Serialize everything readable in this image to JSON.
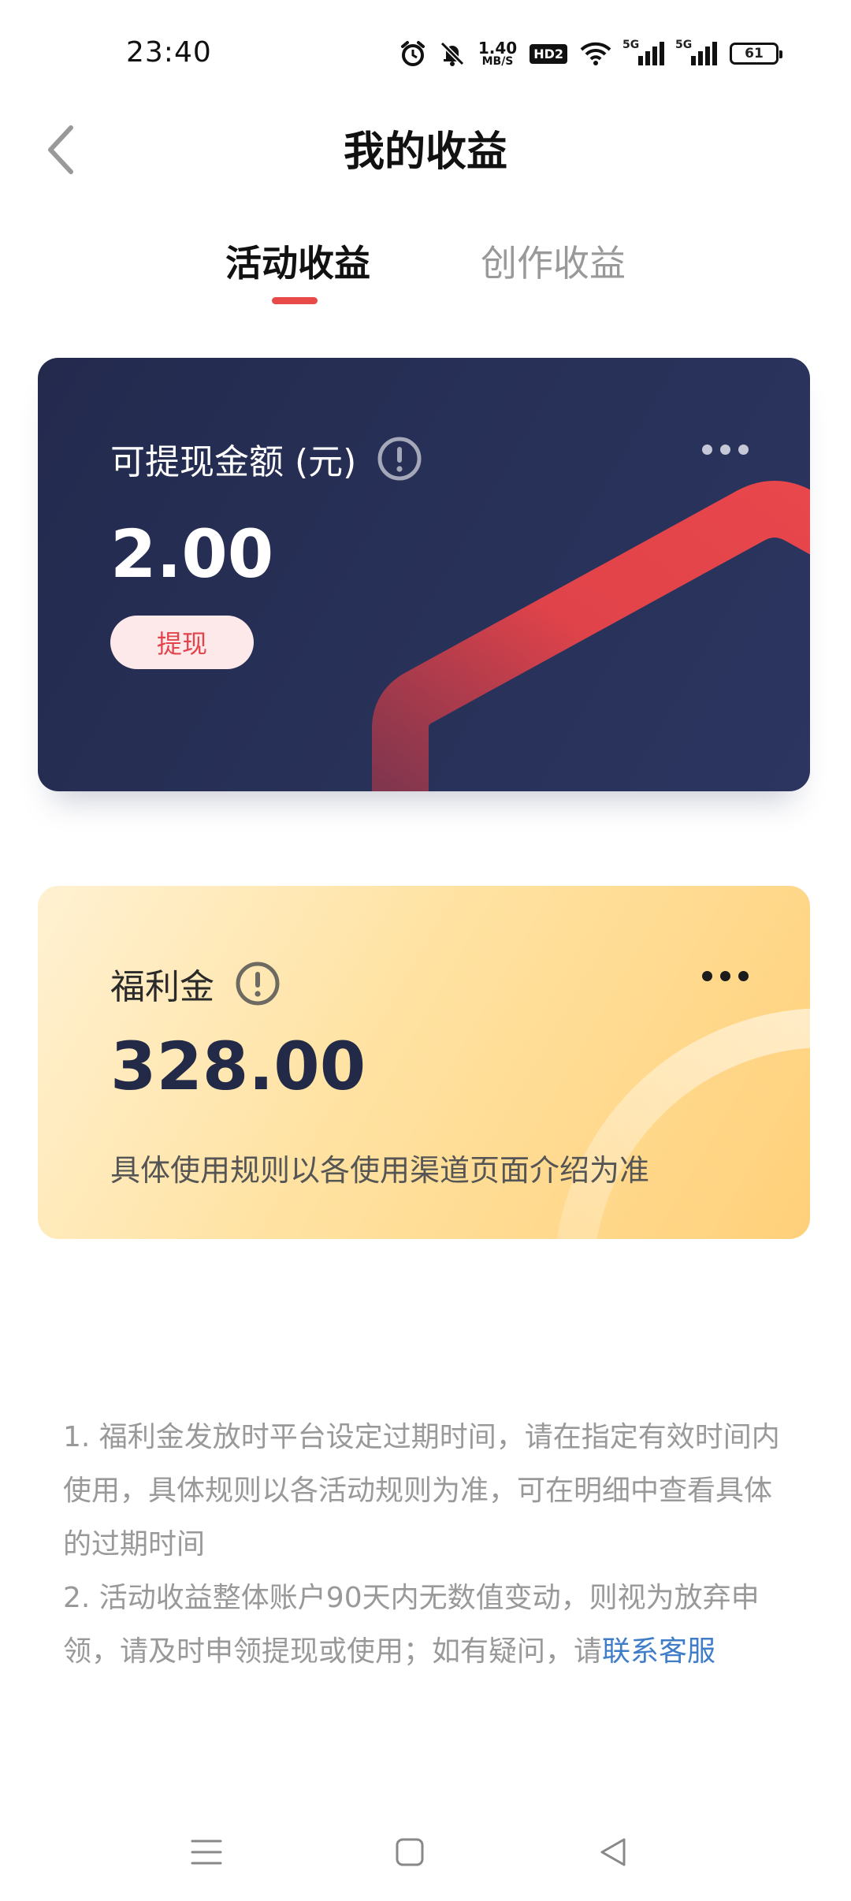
{
  "status_bar": {
    "time": "23:40",
    "net_speed_value": "1.40",
    "net_speed_unit": "MB/S",
    "hd_badge": "HD2",
    "signal1_tag": "5G",
    "signal2_tag": "5G",
    "battery": "61",
    "icons": [
      "alarm-icon",
      "mute-icon",
      "wifi-icon",
      "signal-icon",
      "battery-icon"
    ]
  },
  "header": {
    "title": "我的收益"
  },
  "tabs": [
    {
      "label": "活动收益",
      "active": true
    },
    {
      "label": "创作收益",
      "active": false
    }
  ],
  "balance_card": {
    "label": "可提现金额 (元)",
    "value": "2.00",
    "withdraw_label": "提现"
  },
  "welfare_card": {
    "label": "福利金",
    "value": "328.00",
    "description": "具体使用规则以各使用渠道页面介绍为准"
  },
  "notes": {
    "line1": "1. 福利金发放时平台设定过期时间，请在指定有效时间内使用，具体规则以各活动规则为准，可在明细中查看具体的过期时间",
    "line2_prefix": "2. 活动收益整体账户90天内无数值变动，则视为放弃申领，请及时申领提现或使用；如有疑问，请",
    "contact_link": "联系客服"
  },
  "colors": {
    "accent_red": "#e84a4a",
    "balance_card_bg": "#252c52",
    "welfare_card_bg": "#ffd98e",
    "link_blue": "#3f7dc8"
  }
}
